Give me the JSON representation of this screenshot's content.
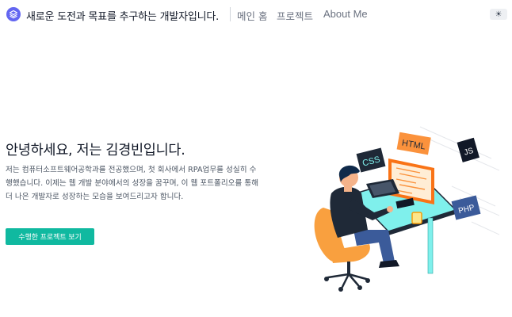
{
  "header": {
    "site_title": "새로운 도전과 목표를 추구하는 개발자입니다.",
    "nav": [
      {
        "label": "메인 홈"
      },
      {
        "label": "프로젝트"
      },
      {
        "label": "About Me"
      }
    ],
    "theme_toggle_icon": "☀"
  },
  "hero": {
    "title": "안녕하세요, 저는 김경빈입니다.",
    "description": "저는 컴퓨터소프트웨어공학과를 전공했으며, 첫 회사에서 RPA업무를 성실히 수행했습니다. 이제는 웹 개발 분야에서의 성장을 꿈꾸며, 이 웹 포트폴리오를 통해 더 나은 개발자로 성장하는 모습을 보여드리고자 합니다.",
    "cta_label": "수행한 프로젝트 보기"
  },
  "illustration": {
    "tags": [
      "HTML",
      "CSS",
      "JS",
      "PHP"
    ]
  },
  "colors": {
    "accent": "#10b9a0",
    "logo": "#6366f1"
  }
}
